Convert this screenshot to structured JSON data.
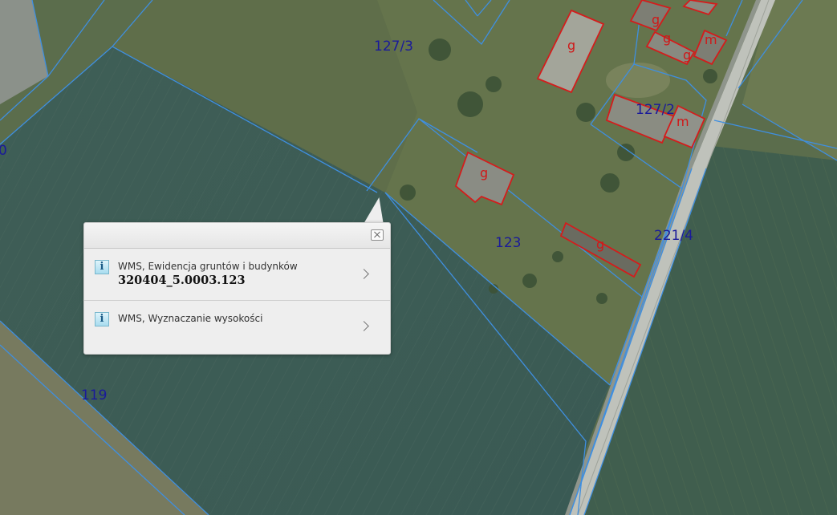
{
  "map": {
    "parcels": [
      {
        "id": "p119",
        "label": "119"
      },
      {
        "id": "p123",
        "label": "123"
      },
      {
        "id": "p127_3",
        "label": "127/3"
      },
      {
        "id": "p127_2",
        "label": "127/2"
      },
      {
        "id": "p221_4",
        "label": "221/4"
      },
      {
        "id": "pedge",
        "label": "0"
      }
    ],
    "building_labels": [
      "g",
      "m"
    ],
    "colors": {
      "parcel_line": "#3f8fe0",
      "building_line": "#d41c1c",
      "parcel_label": "#1a1a9a",
      "building_label": "#d01818"
    }
  },
  "popup": {
    "close_icon": "close-icon",
    "results": [
      {
        "icon": "info-icon",
        "icon_glyph": "i",
        "title": "WMS, Ewidencja gruntów i budynków",
        "value": "320404_5.0003.123"
      },
      {
        "icon": "info-icon",
        "icon_glyph": "i",
        "title": "WMS, Wyznaczanie wysokości",
        "value": ""
      }
    ]
  }
}
